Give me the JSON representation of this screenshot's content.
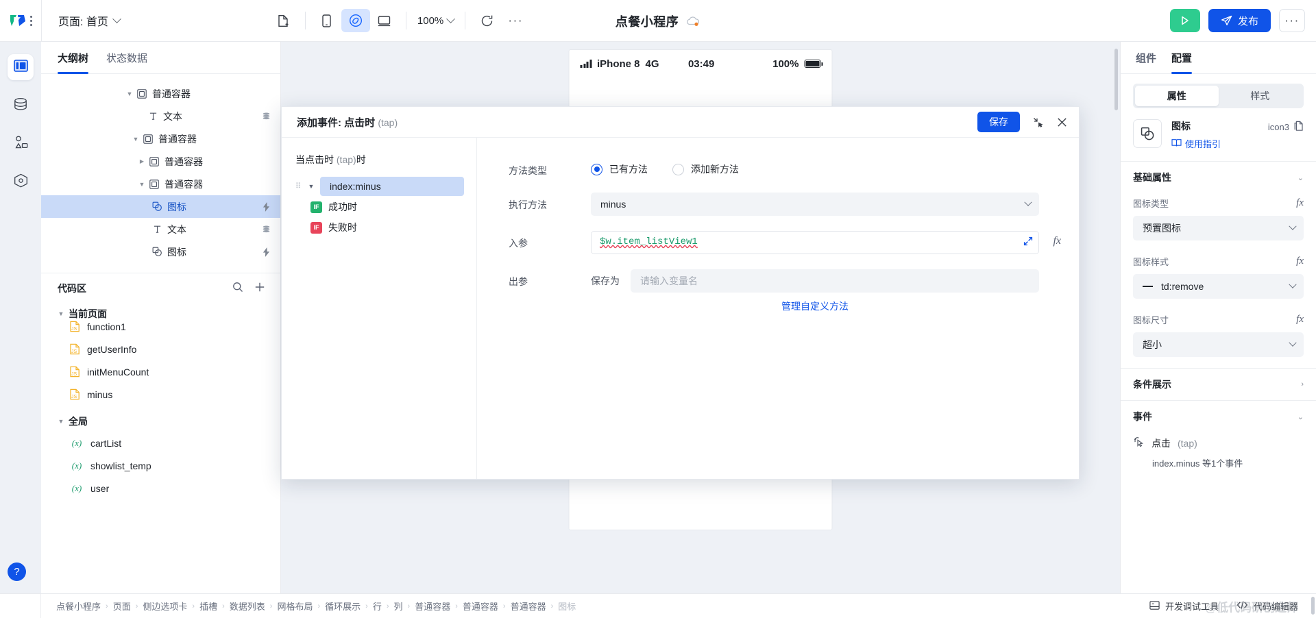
{
  "topbar": {
    "page_label": "页面: 首页",
    "zoom_level": "100%",
    "app_title": "点餐小程序",
    "publish_label": "发布",
    "icons": {
      "logo": "app-logo",
      "menu_dots": "vertical-dots-icon",
      "new_page": "new-page-icon",
      "device_phone": "phone-device-icon",
      "device_mini": "miniprogram-device-icon",
      "device_desktop": "desktop-device-icon",
      "refresh": "refresh-icon",
      "more": "more-horizontal-icon",
      "run": "run-play-icon",
      "publish": "send-plane-icon",
      "cloud": "cloud-status-icon"
    }
  },
  "rail": {
    "items": [
      {
        "name": "layout-panel-icon",
        "active": true
      },
      {
        "name": "database-icon",
        "active": false
      },
      {
        "name": "components-icon",
        "active": false
      },
      {
        "name": "plugin-hexagon-icon",
        "active": false
      }
    ],
    "help_label": "?"
  },
  "left_panel": {
    "tabs": [
      {
        "label": "大纲树",
        "active": true
      },
      {
        "label": "状态数据",
        "active": false
      }
    ],
    "tree": [
      {
        "label": "普通容器",
        "icon": "container-icon",
        "indent": 1,
        "caret": "open",
        "badge": "",
        "selected": false
      },
      {
        "label": "文本",
        "icon": "text-icon",
        "indent": 2,
        "caret": "none",
        "badge": "data-icon",
        "selected": false
      },
      {
        "label": "普通容器",
        "icon": "container-icon",
        "indent": 2,
        "caret": "open",
        "badge": "",
        "selected": false
      },
      {
        "label": "普通容器",
        "icon": "container-icon",
        "indent": 3,
        "caret": "closed",
        "badge": "",
        "selected": false
      },
      {
        "label": "普通容器",
        "icon": "container-icon",
        "indent": 3,
        "caret": "open",
        "badge": "",
        "selected": false
      },
      {
        "label": "图标",
        "icon": "shapes-icon",
        "indent": 4,
        "caret": "none",
        "badge": "event-bolt-icon",
        "selected": true
      },
      {
        "label": "文本",
        "icon": "text-icon",
        "indent": 4,
        "caret": "none",
        "badge": "data-icon",
        "selected": false
      },
      {
        "label": "图标",
        "icon": "shapes-icon",
        "indent": 4,
        "caret": "none",
        "badge": "event-bolt-icon",
        "selected": false
      }
    ],
    "code_area": {
      "title": "代码区",
      "search_icon": "search-icon",
      "add_icon": "plus-icon",
      "groups": [
        {
          "label": "当前页面",
          "items": [
            {
              "name": "function1",
              "kind": "js"
            },
            {
              "name": "getUserInfo",
              "kind": "js"
            },
            {
              "name": "initMenuCount",
              "kind": "js"
            },
            {
              "name": "minus",
              "kind": "js"
            }
          ]
        },
        {
          "label": "全局",
          "items": [
            {
              "name": "cartList",
              "kind": "var"
            },
            {
              "name": "showlist_temp",
              "kind": "var"
            },
            {
              "name": "user",
              "kind": "var"
            }
          ]
        }
      ]
    }
  },
  "canvas": {
    "phone_status": {
      "carrier": "iPhone 8",
      "network": "4G",
      "time": "03:49",
      "battery_pct": "100%"
    }
  },
  "modal": {
    "title_main": "添加事件: 点击时",
    "title_suffix": "(tap)",
    "save_label": "保存",
    "collapse_icon": "collapse-diagonal-icon",
    "close_icon": "close-icon",
    "left": {
      "heading_main": "当点击时",
      "heading_mid": "(tap)",
      "heading_end": "时",
      "chip_label": "index:minus",
      "branches": [
        {
          "tag": "IF",
          "label": "成功时",
          "tone": "ok"
        },
        {
          "tag": "IF",
          "label": "失败时",
          "tone": "fail"
        }
      ]
    },
    "form": {
      "method_type_label": "方法类型",
      "radio_existing": "已有方法",
      "radio_new": "添加新方法",
      "exec_method_label": "执行方法",
      "exec_method_value": "minus",
      "params_in_label": "入参",
      "params_in_value": "$w.item_listView1",
      "params_out_label": "出参",
      "save_as_label": "保存为",
      "save_as_placeholder": "请输入变量名",
      "manage_link": "管理自定义方法",
      "fx_label": "fx"
    }
  },
  "right_panel": {
    "tabs": [
      {
        "label": "组件",
        "active": false
      },
      {
        "label": "配置",
        "active": true
      }
    ],
    "segments": [
      {
        "label": "属性",
        "active": true
      },
      {
        "label": "样式",
        "active": false
      }
    ],
    "component": {
      "thumb_icon": "shapes-icon",
      "name": "图标",
      "guide_label": "使用指引",
      "guide_icon": "book-icon",
      "id": "icon3",
      "copy_icon": "copy-icon"
    },
    "sections": [
      {
        "title": "基础属性",
        "state": "open"
      },
      {
        "title": "条件展示",
        "state": "closed"
      },
      {
        "title": "事件",
        "state": "open"
      }
    ],
    "basic_props": [
      {
        "label": "图标类型",
        "value": "预置图标",
        "fx": "fx",
        "glyph": ""
      },
      {
        "label": "图标样式",
        "value": "td:remove",
        "fx": "fx",
        "glyph": "minus-glyph"
      },
      {
        "label": "图标尺寸",
        "value": "超小",
        "fx": "fx",
        "glyph": ""
      }
    ],
    "events": [
      {
        "icon": "cursor-click-icon",
        "name": "点击",
        "suffix": "(tap)",
        "detail": "index.minus 等1个事件"
      }
    ]
  },
  "bottom_bar": {
    "breadcrumbs": [
      "点餐小程序",
      "页面",
      "侧边选项卡",
      "插槽",
      "数据列表",
      "网格布局",
      "循环展示",
      "行",
      "列",
      "普通容器",
      "普通容器",
      "普通容器",
      "图标"
    ],
    "actions": [
      {
        "label": "开发调试工具",
        "icon": "debug-panel-icon"
      },
      {
        "label": "代码编辑器",
        "icon": "code-brackets-icon"
      }
    ],
    "watermark": "@低代码研创造师"
  },
  "colors": {
    "accent": "#1054e8",
    "selection": "#c9daf8",
    "run_green": "#2ecc8f",
    "success": "#23b26d",
    "fail": "#e8445a",
    "code_green": "#1b9b6c",
    "canvas_bg": "#eef1f6"
  }
}
